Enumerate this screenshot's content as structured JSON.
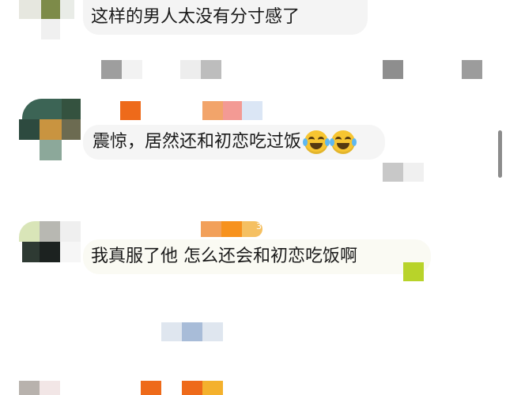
{
  "comments": [
    {
      "text": "这样的男人太没有分寸感了"
    },
    {
      "text": "震惊，居然还和初恋吃过饭"
    },
    {
      "text": "我真服了他 怎么还会和初恋吃饭啊"
    }
  ],
  "badges": {
    "level_count": "3"
  },
  "icons": {
    "emoji": "crying-laughing-face-icon"
  },
  "colors": {
    "bubble_bg": "#f5f5f5",
    "meta_text": "#b4b4b4",
    "username_accent": "#ee6a1a"
  }
}
